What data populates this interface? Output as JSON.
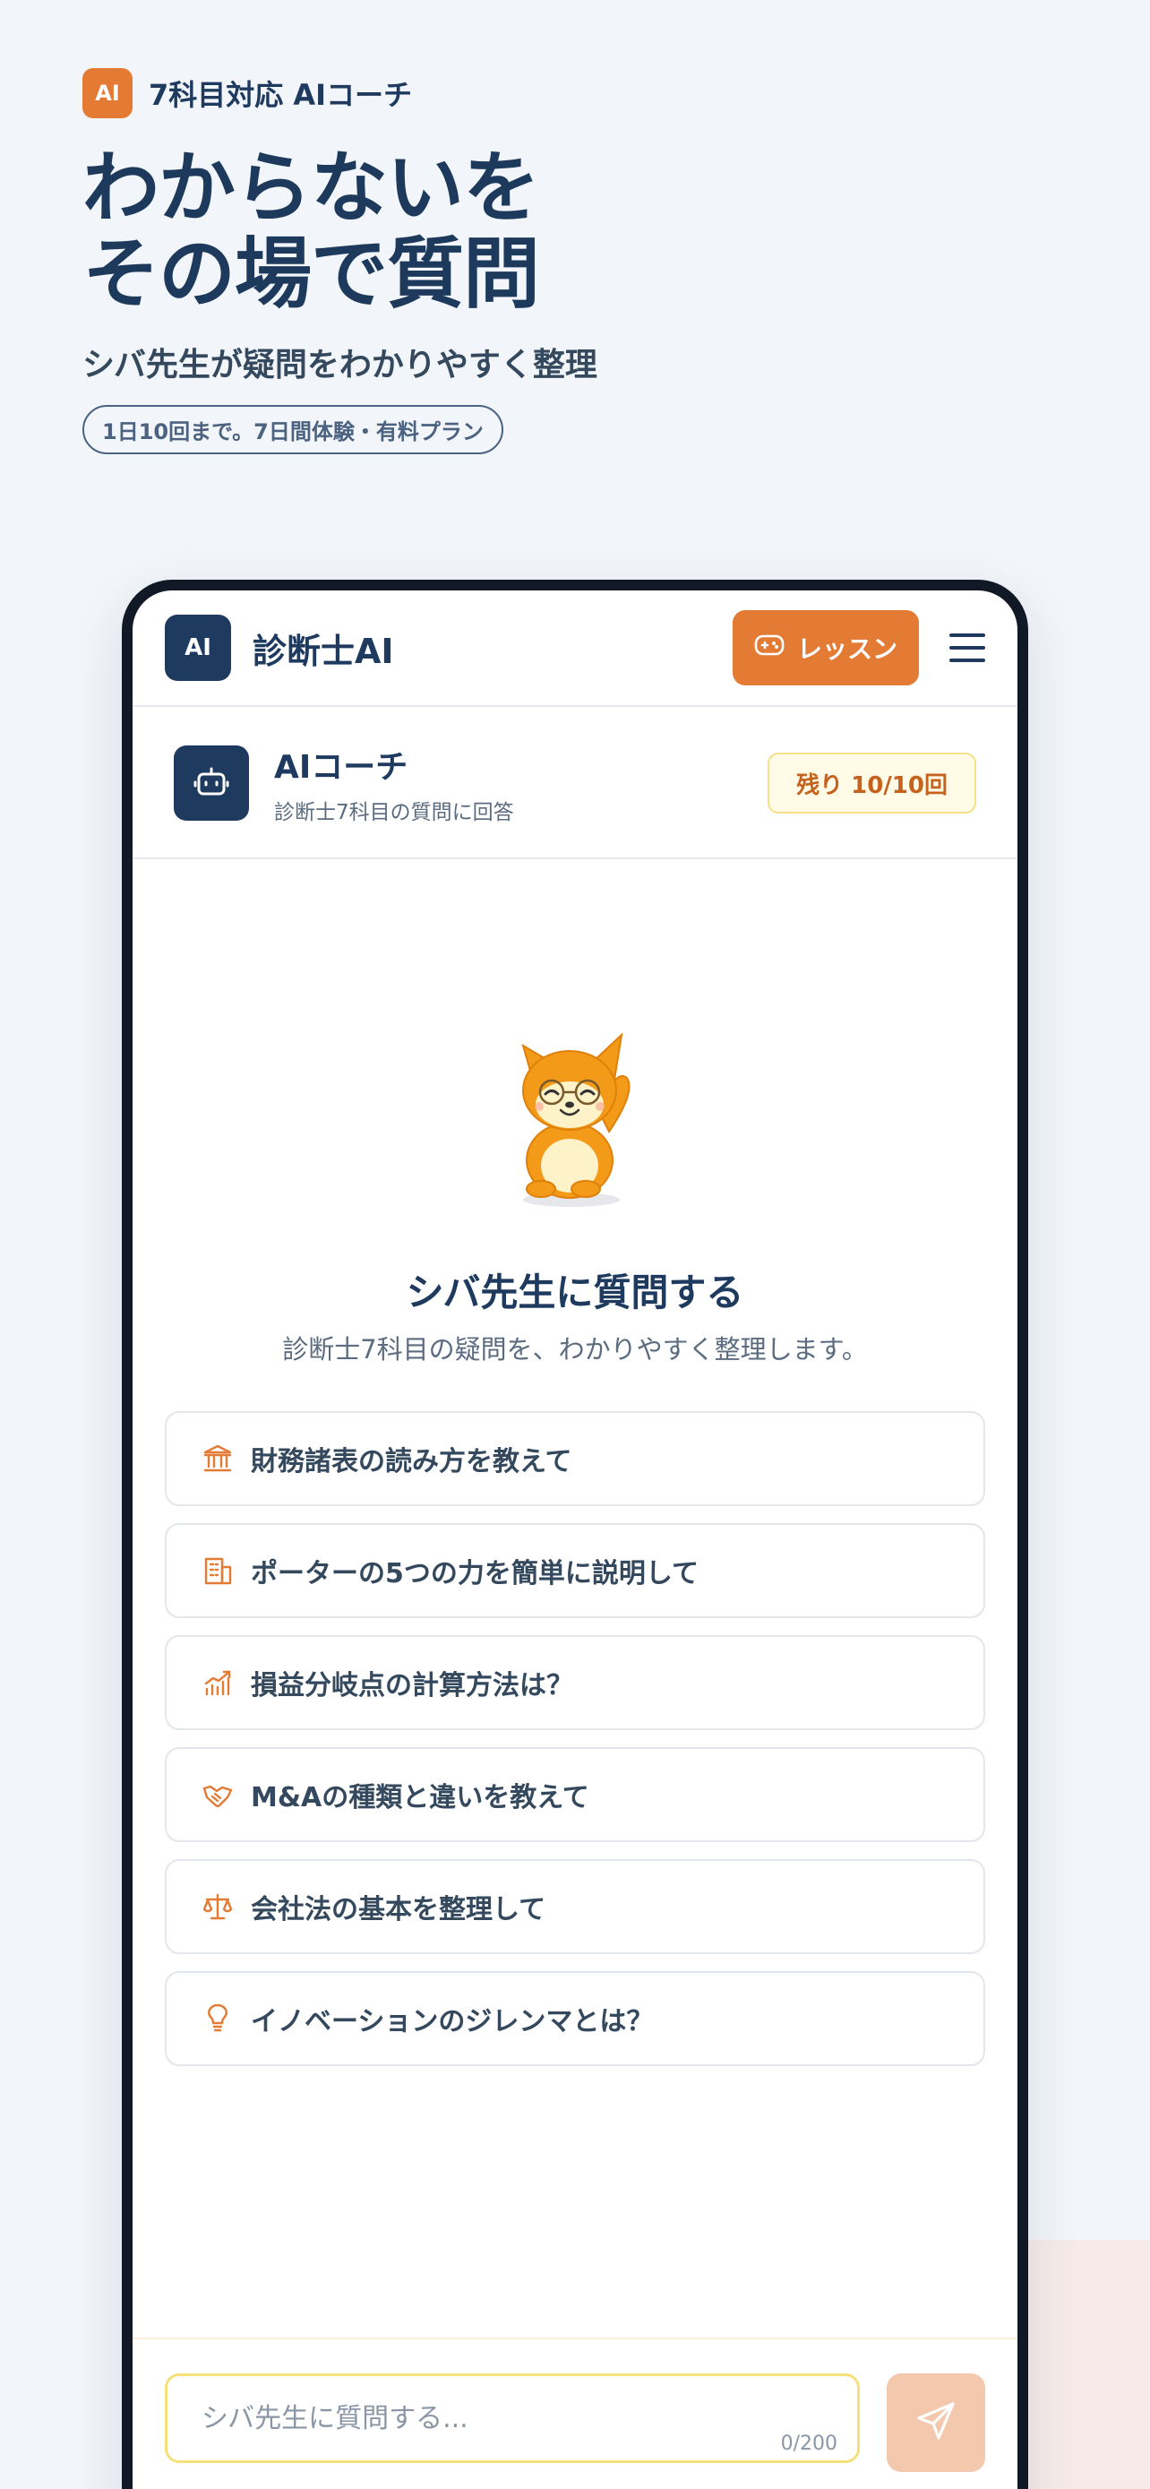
{
  "hero": {
    "badge_label": "AI",
    "badge_text": "7科目対応 AIコーチ",
    "headline_line1": "わからないを",
    "headline_line2": "その場で質問",
    "subhead": "シバ先生が疑問をわかりやすく整理",
    "pill": "1日10回まで。7日間体験・有料プラン"
  },
  "topbar": {
    "logo_label": "AI",
    "app_name": "診断士AI",
    "lesson_label": "レッスン"
  },
  "coach": {
    "title": "AIコーチ",
    "subtitle": "診断士7科目の質問に回答",
    "remaining": "残り 10/10回"
  },
  "empty": {
    "title": "シバ先生に質問する",
    "subtitle": "診断士7科目の疑問を、わかりやすく整理します。"
  },
  "suggestions": [
    {
      "icon": "bank-icon",
      "label": "財務諸表の読み方を教えて"
    },
    {
      "icon": "building-icon",
      "label": "ポーターの5つの力を簡単に説明して"
    },
    {
      "icon": "chart-icon",
      "label": "損益分岐点の計算方法は？"
    },
    {
      "icon": "handshake-icon",
      "label": "M&Aの種類と違いを教えて"
    },
    {
      "icon": "scale-icon",
      "label": "会社法の基本を整理して"
    },
    {
      "icon": "lightbulb-icon",
      "label": "イノベーションのジレンマとは？"
    }
  ],
  "composer": {
    "placeholder": "シバ先生に質問する...",
    "counter": "0/200"
  },
  "colors": {
    "accent": "#e47b35",
    "navy": "#1e3a5f",
    "background": "#f2f5f9"
  }
}
